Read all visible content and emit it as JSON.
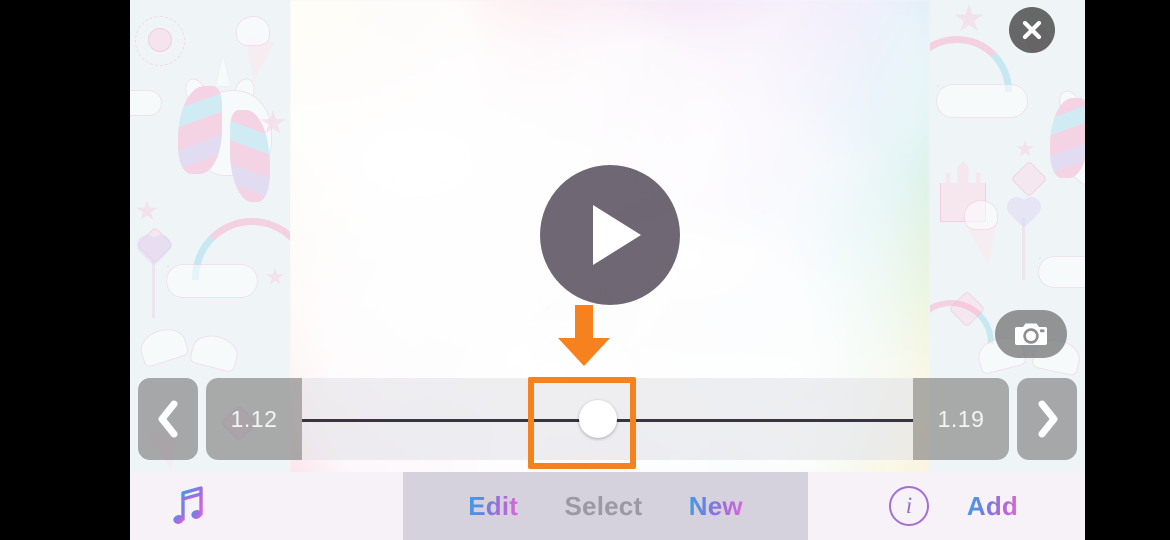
{
  "app": {
    "name": "video-slideshow-editor"
  },
  "media": {
    "description": "pastel rainbow cloud photo",
    "play_state": "paused"
  },
  "overlay_buttons": {
    "close": {
      "name": "close",
      "glyph": "✕"
    },
    "camera": {
      "name": "camera",
      "glyph": "camera"
    },
    "play": {
      "name": "play",
      "glyph": "▶"
    }
  },
  "slider": {
    "prev_label": "❮",
    "next_label": "❯",
    "start_time": "1.12",
    "end_time": "1.19",
    "thumb_position_percent": 48.5,
    "thumb_name": "slider-thumb"
  },
  "annotation": {
    "color": "#f5811f",
    "arrow_direction": "down",
    "target": "slider-thumb",
    "highlight_shape": "rectangle"
  },
  "toolbar": {
    "music_icon": "music-note",
    "items": [
      {
        "label": "Edit",
        "style": "gradient"
      },
      {
        "label": "Select",
        "style": "gray"
      },
      {
        "label": "New",
        "style": "gradient"
      }
    ],
    "info_label": "i",
    "add_label": "Add"
  },
  "colors": {
    "accent_orange": "#f5811f",
    "gradient_start": "#3aa0e8",
    "gradient_end": "#e06ad8",
    "toolbar_bg": "#f6f2f7",
    "toolbar_mid_bg": "#d5d2dd",
    "chip_gray": "rgba(120,120,120,.60)",
    "letterbox": "#000000"
  },
  "wallpaper": {
    "theme": "unicorn-pastel",
    "motifs": [
      "unicorn",
      "rainbow",
      "cloud",
      "star",
      "ice-cream",
      "diamond",
      "castle",
      "magic-wand",
      "shell",
      "sun"
    ]
  }
}
